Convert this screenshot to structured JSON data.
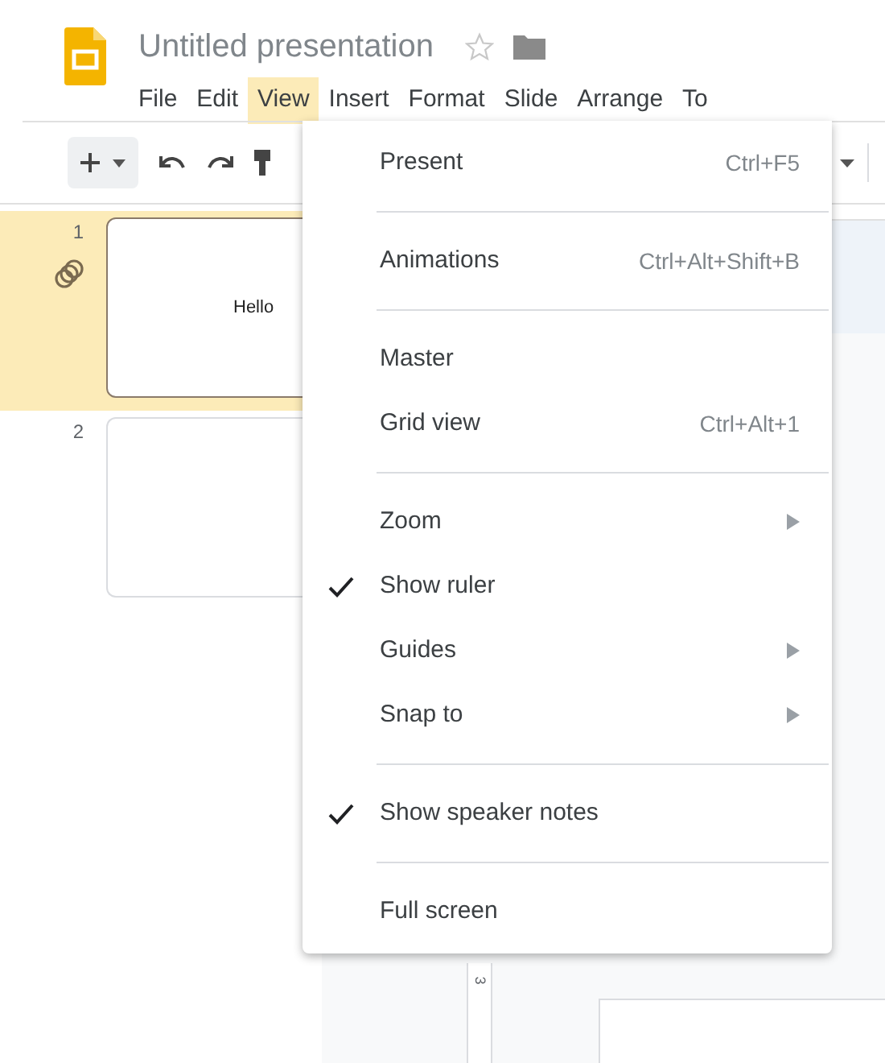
{
  "document": {
    "title": "Untitled presentation",
    "starred": false
  },
  "menu_bar": [
    {
      "label": "File",
      "selected": false
    },
    {
      "label": "Edit",
      "selected": false
    },
    {
      "label": "View",
      "selected": true
    },
    {
      "label": "Insert",
      "selected": false
    },
    {
      "label": "Format",
      "selected": false
    },
    {
      "label": "Slide",
      "selected": false
    },
    {
      "label": "Arrange",
      "selected": false
    },
    {
      "label": "To",
      "selected": false
    }
  ],
  "filmstrip": [
    {
      "number": "1",
      "selected": true,
      "animated": true,
      "text": "Hello"
    },
    {
      "number": "2",
      "selected": false,
      "animated": false
    }
  ],
  "ruler": {
    "mark": "3"
  },
  "view_menu": {
    "sections": [
      [
        {
          "label": "Present",
          "shortcut": "Ctrl+F5",
          "checked": false,
          "submenu": false
        }
      ],
      [
        {
          "label": "Animations",
          "shortcut": "Ctrl+Alt+Shift+B",
          "checked": false,
          "submenu": false
        }
      ],
      [
        {
          "label": "Master",
          "checked": false,
          "submenu": false
        },
        {
          "label": "Grid view",
          "shortcut": "Ctrl+Alt+1",
          "checked": false,
          "submenu": false
        }
      ],
      [
        {
          "label": "Zoom",
          "checked": false,
          "submenu": true
        },
        {
          "label": "Show ruler",
          "checked": true,
          "submenu": false
        },
        {
          "label": "Guides",
          "checked": false,
          "submenu": true
        },
        {
          "label": "Snap to",
          "checked": false,
          "submenu": true
        }
      ],
      [
        {
          "label": "Show speaker notes",
          "checked": true,
          "submenu": false
        }
      ],
      [
        {
          "label": "Full screen",
          "checked": false,
          "submenu": false
        }
      ]
    ]
  }
}
